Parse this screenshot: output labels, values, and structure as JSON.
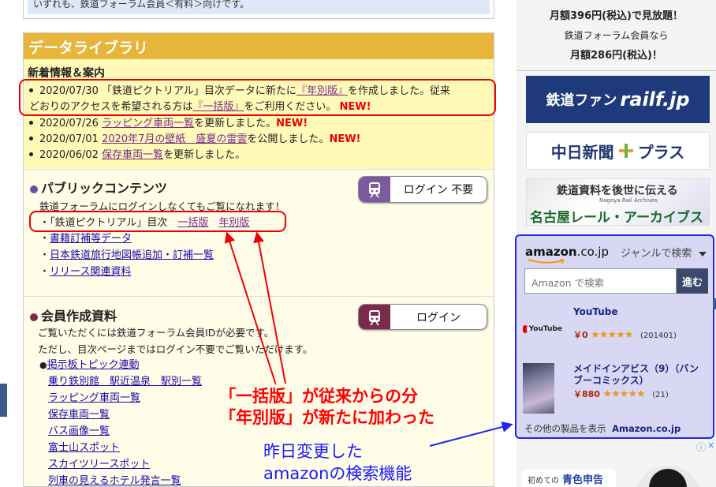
{
  "top_notice": "いずれも、鉄道フォーラム会員＜有料＞向けです。",
  "library": {
    "title": "データライブラリ",
    "news_heading": "新着情報＆案内",
    "news": [
      {
        "pre": "2020/07/30 「鉄道ピクトリアル」目次データに新たに",
        "l1": "『年別版』",
        "mid": "を作成しました。従来",
        "line2_pre": "どおりのアクセスを希望される方は",
        "l2": "『一括版』",
        "post": "をご利用ください。",
        "badge": "NEW!"
      },
      {
        "pre": "2020/07/26 ",
        "link": "ラッピング車両一覧",
        "post": "を更新しました。",
        "badge": "NEW!"
      },
      {
        "pre": "2020/07/01 ",
        "link": "2020年7月の壁紙　盛夏の雷雲",
        "post": "を公開しました。",
        "badge": "NEW!"
      },
      {
        "pre": "2020/06/02 ",
        "link": "保存車両一覧",
        "post": "を更新しました。",
        "badge": ""
      }
    ]
  },
  "public": {
    "heading": "パブリックコンテンツ",
    "login_label": "ログイン 不要",
    "desc": "鉄道フォーラムにログインしなくてもご覧になれます！",
    "pictorial_prefix": "・「鉄道ピクトリアル」目次",
    "pictorial_link1": "一括版",
    "pictorial_link2": "年別版",
    "items": [
      "書籍訂補等データ",
      "日本鉄道旅行地図帳追加・訂補一覧",
      "リリース関連資料"
    ]
  },
  "member": {
    "heading": "会員作成資料",
    "login_label": "ログイン",
    "desc1": "ご覧いただくには鉄道フォーラム会員IDが必要です。",
    "desc2": "ただし、目次ページまではログイン不要でご覧いただけます。",
    "first": "掲示板トピック連動",
    "items": [
      "乗り鉄別館　駅近温泉　駅別一覧",
      "ラッピング車両一覧",
      "保存車両一覧",
      "バス画像一覧",
      "富士山スポット",
      "スカイツリースポット",
      "列車の見えるホテル発言一覧"
    ]
  },
  "sidebar": {
    "line1": "月額396円(税込)で見放題！",
    "line2": "鉄道フォーラム会員なら",
    "line3": "月額286円(税込)！",
    "banner1_jp": "鉄道ファン",
    "banner1_en": "railf.jp",
    "banner2_a": "中日新聞",
    "banner2_b": "プラス",
    "banner3_top": "鉄道資料を後世に伝える",
    "banner3_sub": "Nagoya Rail Archives",
    "banner3_main": "名古屋レール・アーカイブス"
  },
  "amazon": {
    "logo": "amazon",
    "logo_tld": ".co.jp",
    "genre": "ジャンルで検索",
    "search_placeholder": "Amazon で検索",
    "go": "進む",
    "products": [
      {
        "title": "YouTube",
        "thumb_text": "YouTube",
        "price": "￥0",
        "stars": "★★★★★",
        "count": "(201401)"
      },
      {
        "title": "メイドインアビス（9）（バンブーコミックス）",
        "thumb_text": "",
        "price": "￥880",
        "stars": "★★★★★",
        "count": "(21)"
      }
    ],
    "footer_text": "その他の製品を表示",
    "footer_link": "Amazon.co.jp"
  },
  "ad": {
    "info": "ⓘ",
    "close": "✕",
    "text_pre": "初めての",
    "text_main": "青色申告"
  },
  "annotations": {
    "red1": "「一括版」が従来からの分",
    "red2": "「年別版」が新たに加わった",
    "blue1": "昨日変更した",
    "blue2": "amazonの検索機能"
  }
}
